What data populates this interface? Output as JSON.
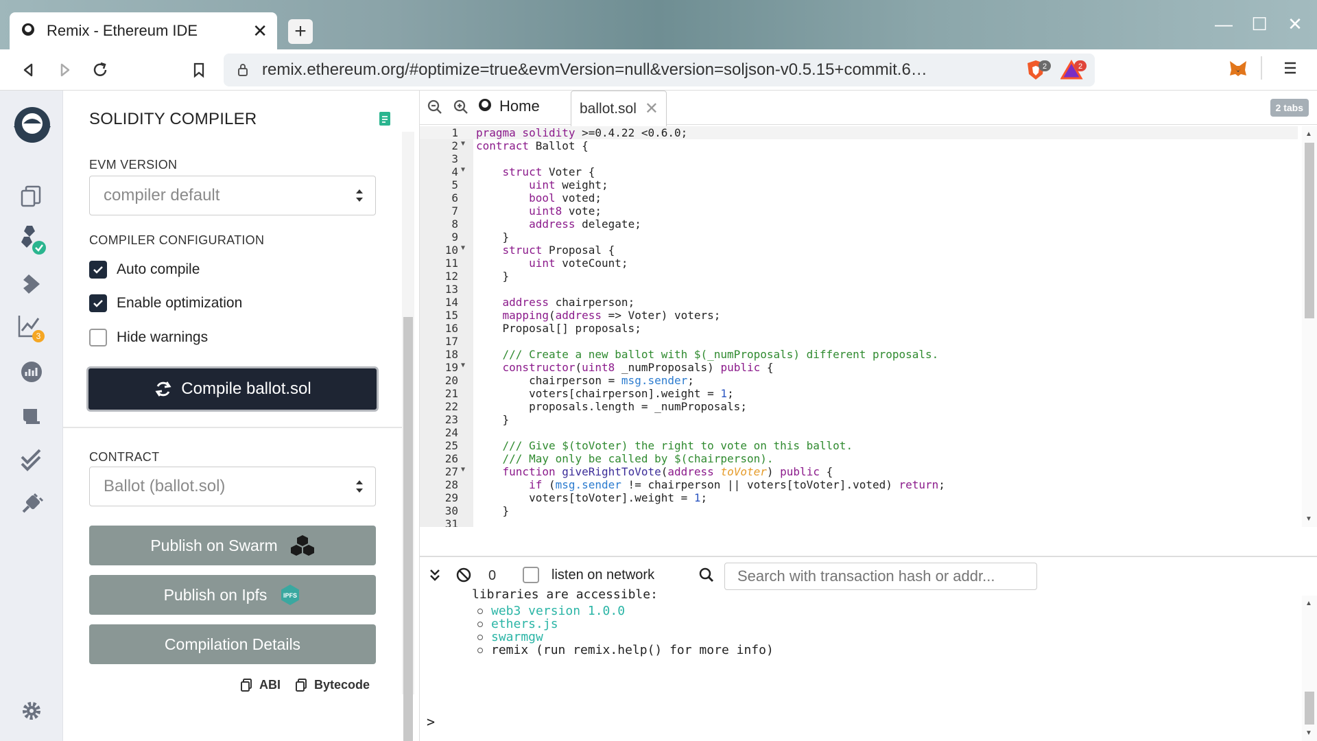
{
  "browser": {
    "tab_title": "Remix - Ethereum IDE",
    "tab_close": "✕",
    "new_tab": "+",
    "url": "remix.ethereum.org/#optimize=true&evmVersion=null&version=soljson-v0.5.15+commit.6…",
    "brave_badge": "2",
    "rewards_badge": "2"
  },
  "iconbar": {
    "analytics_badge": "3"
  },
  "compiler": {
    "title": "SOLIDITY COMPILER",
    "evm_label": "EVM VERSION",
    "evm_value": "compiler default",
    "config_label": "COMPILER CONFIGURATION",
    "auto_compile": "Auto compile",
    "enable_optimization": "Enable optimization",
    "hide_warnings": "Hide warnings",
    "compile_button": "Compile ballot.sol",
    "contract_label": "CONTRACT",
    "contract_value": "Ballot (ballot.sol)",
    "publish_swarm": "Publish on Swarm",
    "publish_ipfs": "Publish on Ipfs",
    "ipfs_logo": "IPFS",
    "compilation_details": "Compilation Details",
    "abi": "ABI",
    "bytecode": "Bytecode"
  },
  "editor": {
    "home_tab": "Home",
    "file_tab": "ballot.sol",
    "tab_count": "2 tabs",
    "lines": [
      {
        "n": "1",
        "fold": false,
        "html": "<span class='kw'>pragma solidity</span> >=0.4.22 <0.6.0;"
      },
      {
        "n": "2",
        "fold": true,
        "html": "<span class='kw'>contract</span> Ballot {"
      },
      {
        "n": "3",
        "fold": false,
        "html": ""
      },
      {
        "n": "4",
        "fold": true,
        "html": "    <span class='kw'>struct</span> Voter {"
      },
      {
        "n": "5",
        "fold": false,
        "html": "        <span class='kw'>uint</span> weight;"
      },
      {
        "n": "6",
        "fold": false,
        "html": "        <span class='kw'>bool</span> voted;"
      },
      {
        "n": "7",
        "fold": false,
        "html": "        <span class='kw'>uint8</span> vote;"
      },
      {
        "n": "8",
        "fold": false,
        "html": "        <span class='kw'>address</span> delegate;"
      },
      {
        "n": "9",
        "fold": false,
        "html": "    }"
      },
      {
        "n": "10",
        "fold": true,
        "html": "    <span class='kw'>struct</span> Proposal {"
      },
      {
        "n": "11",
        "fold": false,
        "html": "        <span class='kw'>uint</span> voteCount;"
      },
      {
        "n": "12",
        "fold": false,
        "html": "    }"
      },
      {
        "n": "13",
        "fold": false,
        "html": ""
      },
      {
        "n": "14",
        "fold": false,
        "html": "    <span class='kw'>address</span> chairperson;"
      },
      {
        "n": "15",
        "fold": false,
        "html": "    <span class='kw'>mapping</span>(<span class='kw'>address</span> => Voter) voters;"
      },
      {
        "n": "16",
        "fold": false,
        "html": "    Proposal[] proposals;"
      },
      {
        "n": "17",
        "fold": false,
        "html": ""
      },
      {
        "n": "18",
        "fold": false,
        "html": "    <span class='cm'>/// Create a new ballot with $(_numProposals) different proposals.</span>"
      },
      {
        "n": "19",
        "fold": true,
        "html": "    <span class='kw'>constructor</span>(<span class='kw'>uint8</span> _numProposals) <span class='kw'>public</span> {"
      },
      {
        "n": "20",
        "fold": false,
        "html": "        chairperson = <span class='bi'>msg.sender</span>;"
      },
      {
        "n": "21",
        "fold": false,
        "html": "        voters[chairperson].weight = <span class='nu'>1</span>;"
      },
      {
        "n": "22",
        "fold": false,
        "html": "        proposals.length = _numProposals;"
      },
      {
        "n": "23",
        "fold": false,
        "html": "    }"
      },
      {
        "n": "24",
        "fold": false,
        "html": ""
      },
      {
        "n": "25",
        "fold": false,
        "html": "    <span class='cm'>/// Give $(toVoter) the right to vote on this ballot.</span>"
      },
      {
        "n": "26",
        "fold": false,
        "html": "    <span class='cm'>/// May only be called by $(chairperson).</span>"
      },
      {
        "n": "27",
        "fold": true,
        "html": "    <span class='kw'>function</span> <span class='fn'>giveRightToVote</span>(<span class='kw'>address</span> <span class='pa'>toVoter</span>) <span class='kw'>public</span> {"
      },
      {
        "n": "28",
        "fold": false,
        "html": "        <span class='kw'>if</span> (<span class='bi'>msg.sender</span> != chairperson || voters[toVoter].voted) <span class='kw'>return</span>;"
      },
      {
        "n": "29",
        "fold": false,
        "html": "        voters[toVoter].weight = <span class='nu'>1</span>;"
      },
      {
        "n": "30",
        "fold": false,
        "html": "    }"
      },
      {
        "n": "31",
        "fold": false,
        "html": ""
      }
    ]
  },
  "terminal": {
    "tx_count": "0",
    "listen_label": "listen on network",
    "search_placeholder": "Search with transaction hash or addr...",
    "header_line": "libraries are accessible:",
    "items": [
      {
        "text": "web3 version 1.0.0",
        "link": true
      },
      {
        "text": "ethers.js",
        "link": true
      },
      {
        "text": "swarmgw",
        "link": true
      },
      {
        "text": "remix (run remix.help() for more info)",
        "link": false
      }
    ],
    "prompt": ">"
  },
  "colors": {
    "link": "#2bb5a6",
    "dark_button": "#1e2533",
    "grey_button": "#8a9795",
    "badge_orange": "#f5a623",
    "check_green": "#2bb58f"
  }
}
